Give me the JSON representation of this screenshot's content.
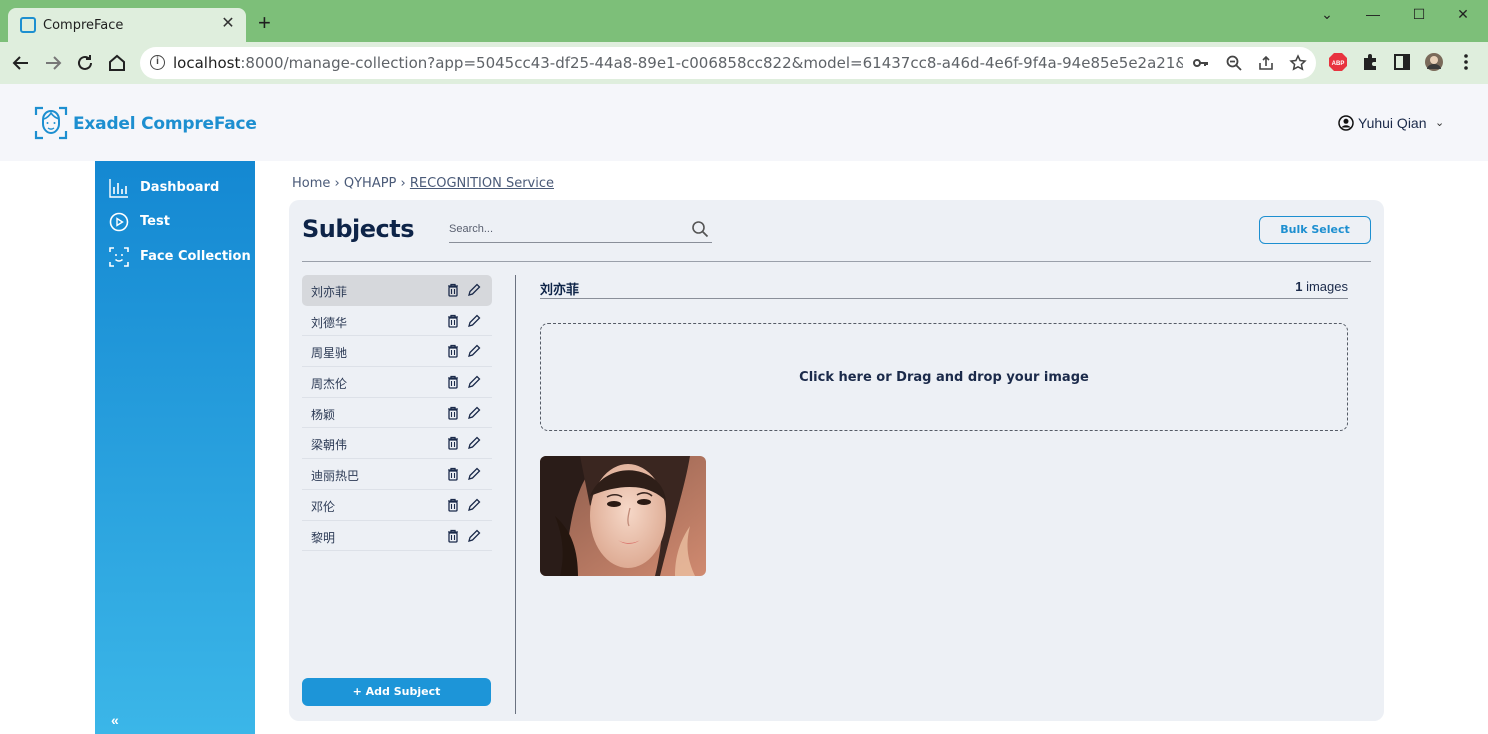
{
  "browser": {
    "tab_title": "CompreFace",
    "tab_close": "✕",
    "new_tab": "+",
    "url_host": "localhost",
    "url_rest": ":8000/manage-collection?app=5045cc43-df25-44a8-89e1-c006858cc822&model=61437cc8-a46d-4e6f-9f4a-94e85e5e2a21&type=RECOG...",
    "window_controls": [
      "⌄",
      "—",
      "☐",
      "✕"
    ]
  },
  "header": {
    "logo_text": "Exadel CompreFace",
    "user_name": "Yuhui Qian",
    "user_chevron": "⌄"
  },
  "sidebar": {
    "items": [
      {
        "label": "Dashboard",
        "icon": "chart-bars-icon"
      },
      {
        "label": "Test",
        "icon": "play-circle-icon"
      },
      {
        "label": "Face Collection",
        "icon": "face-scan-icon"
      }
    ],
    "collapse_label": "«"
  },
  "breadcrumb": {
    "home": "Home",
    "sep": "›",
    "app": "QYHAPP",
    "service": "RECOGNITION Service"
  },
  "subjects": {
    "title": "Subjects",
    "search_placeholder": "Search...",
    "bulk_select": "Bulk Select",
    "add_subject": "+ Add Subject",
    "list": [
      "刘亦菲",
      "刘德华",
      "周星驰",
      "周杰伦",
      "杨颖",
      "梁朝伟",
      "迪丽热巴",
      "邓伦",
      "黎明"
    ],
    "active_index": 0
  },
  "detail": {
    "name": "刘亦菲",
    "image_count": "1",
    "image_count_label": "images",
    "dropzone_text": "Click here or Drag and drop your image"
  },
  "colors": {
    "accent": "#1d8fd0",
    "sidebar_top": "#1488d2",
    "sidebar_bottom": "#3bb6e8",
    "browser_green": "#7dbf79",
    "panel_bg": "#edf0f5",
    "title_navy": "#0e2448"
  }
}
